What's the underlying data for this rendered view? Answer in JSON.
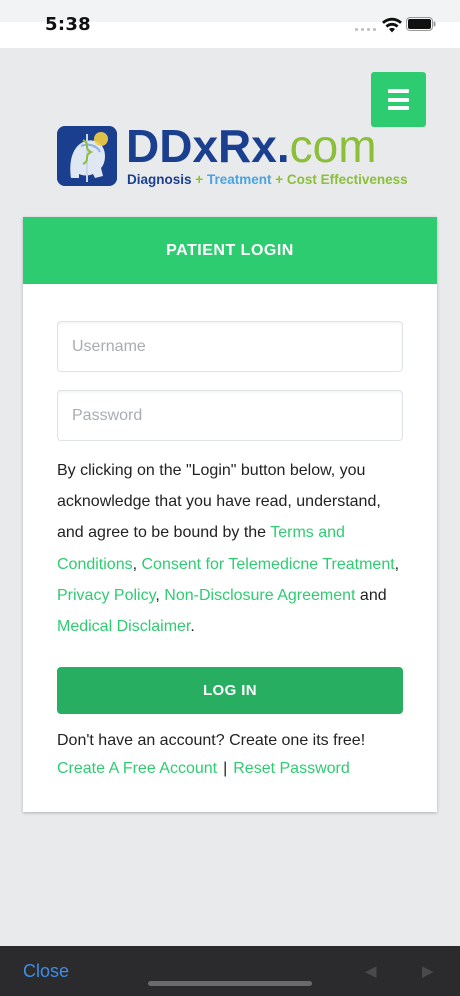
{
  "status_bar": {
    "time": "5:38",
    "icons": [
      "signal-icon",
      "wifi-icon",
      "battery-icon"
    ]
  },
  "header": {
    "menu_icon": "hamburger-menu-icon",
    "logo": {
      "brand_ddx": "DDxRx",
      "brand_dot": ".",
      "brand_com": "com",
      "tagline_diagnosis": "Diagnosis",
      "tagline_plus": "+",
      "tagline_treatment": "Treatment",
      "tagline_cost": "Cost Effectiveness",
      "colors": {
        "navy": "#1b3f8f",
        "green": "#8bbf3a"
      }
    }
  },
  "login": {
    "title": "PATIENT LOGIN",
    "username_placeholder": "Username",
    "password_placeholder": "Password",
    "agreement": {
      "intro": "By clicking on the \"Login\" button below, you acknowledge that you have read, understand, and agree to be bound by the ",
      "terms": "Terms and Conditions",
      "comma1": ", ",
      "consent": "Consent for Telemedicne Treatment",
      "comma2": ", ",
      "privacy": "Privacy Policy",
      "comma3": ", ",
      "nda": "Non-Disclosure Agreement",
      "and": " and ",
      "disclaimer": "Medical Disclaimer",
      "period": "."
    },
    "button_label": "LOG IN",
    "no_account": "Don't have an account? Create one its free!",
    "create_account": "Create A Free Account",
    "separator": "|",
    "reset_password": "Reset Password"
  },
  "bottom_bar": {
    "close_label": "Close",
    "back_icon": "back-arrow-icon",
    "forward_icon": "forward-arrow-icon"
  },
  "colors": {
    "accent_green": "#2ecc71",
    "button_green": "#27ae60",
    "background": "#e8eaec",
    "link_blue": "#3d8ee8"
  }
}
